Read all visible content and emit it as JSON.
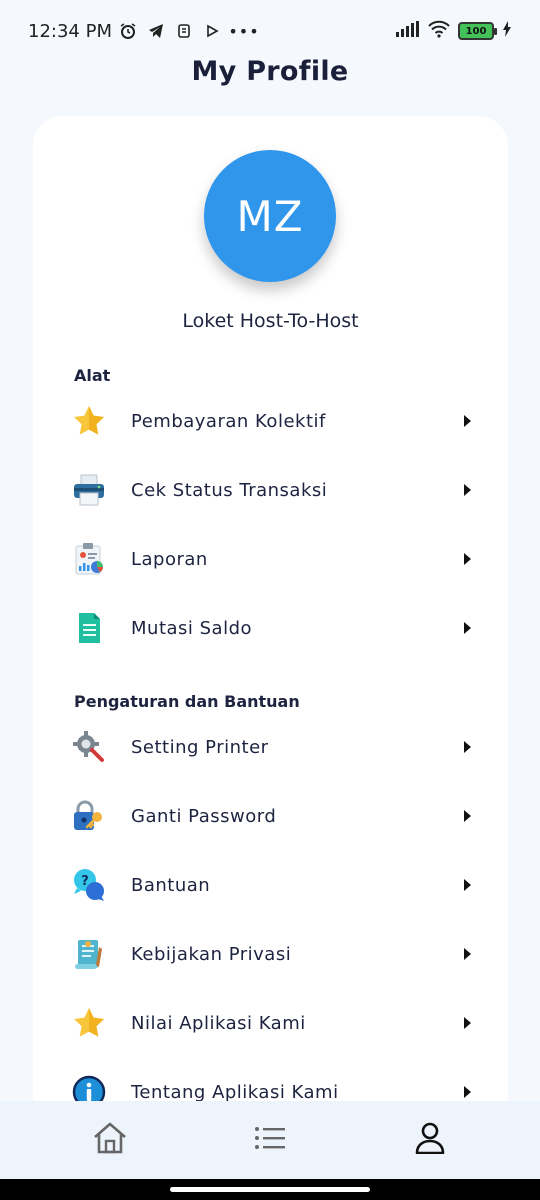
{
  "status_bar": {
    "time": "12:34 PM",
    "battery": "100",
    "icons_left": [
      "alarm-icon",
      "telegram-icon",
      "notification-icon",
      "play-icon",
      "more-dots-icon"
    ],
    "icons_right": [
      "signal-icon",
      "wifi-icon",
      "battery-icon",
      "charging-icon"
    ]
  },
  "header": {
    "title": "My Profile"
  },
  "profile": {
    "initials": "MZ",
    "name": "Loket Host-To-Host",
    "avatar_color": "#2f96ec"
  },
  "sections": {
    "tools": {
      "title": "Alat",
      "items": [
        {
          "label": "Pembayaran Kolektif",
          "icon": "star-icon"
        },
        {
          "label": "Cek Status Transaksi",
          "icon": "printer-icon"
        },
        {
          "label": "Laporan",
          "icon": "report-icon"
        },
        {
          "label": "Mutasi Saldo",
          "icon": "document-icon"
        }
      ]
    },
    "settings": {
      "title": "Pengaturan dan Bantuan",
      "items": [
        {
          "label": "Setting Printer",
          "icon": "gear-search-icon"
        },
        {
          "label": "Ganti Password",
          "icon": "lock-key-icon"
        },
        {
          "label": "Bantuan",
          "icon": "help-chat-icon"
        },
        {
          "label": "Kebijakan Privasi",
          "icon": "policy-scroll-icon"
        },
        {
          "label": "Nilai Aplikasi Kami",
          "icon": "star-icon"
        },
        {
          "label": "Tentang Aplikasi Kami",
          "icon": "info-icon"
        }
      ]
    }
  },
  "bottom_nav": [
    {
      "name": "home",
      "icon": "home-icon"
    },
    {
      "name": "list",
      "icon": "list-icon"
    },
    {
      "name": "profile",
      "icon": "user-icon",
      "active": true
    }
  ],
  "colors": {
    "background": "#f5f8fd",
    "card": "#ffffff",
    "nav_background": "#eef4fc",
    "text": "#1e2340"
  }
}
